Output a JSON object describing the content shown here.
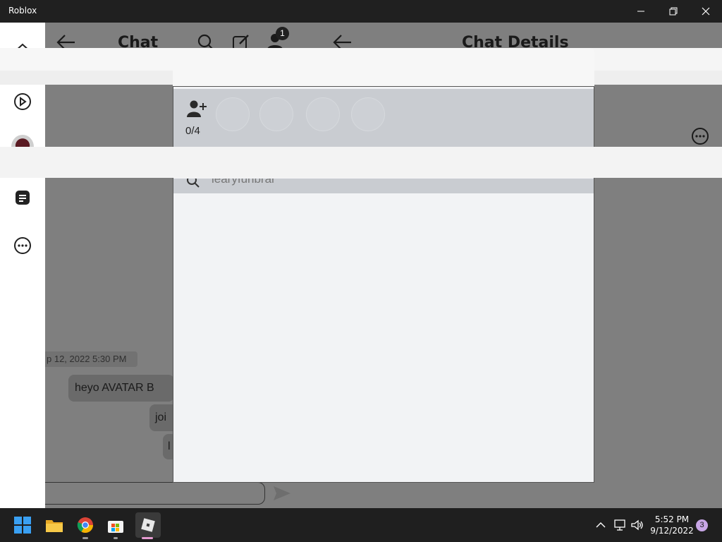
{
  "window": {
    "title": "Roblox",
    "controls": [
      "minimize-icon",
      "maximize-icon",
      "close-icon"
    ]
  },
  "nav_rail": {
    "items": [
      "home-icon",
      "play-icon",
      "avatar",
      "chat-icon",
      "more-icon"
    ]
  },
  "chat_panel": {
    "title": "Chat",
    "friend_request_badge": "1",
    "timestamp": "p 12, 2022 5:30 PM",
    "messages": [
      "heyo AVATAR B",
      "joi",
      "l"
    ]
  },
  "details_panel": {
    "title": "Chat Details"
  },
  "modal": {
    "participant_count": "0/4",
    "search_text": "iearyfunbrar"
  },
  "taskbar": {
    "apps": [
      "start-icon",
      "file-explorer-icon",
      "chrome-icon",
      "microsoft-store-icon",
      "roblox-icon"
    ],
    "time": "5:52 PM",
    "date": "9/12/2022",
    "notification_count": "3"
  }
}
